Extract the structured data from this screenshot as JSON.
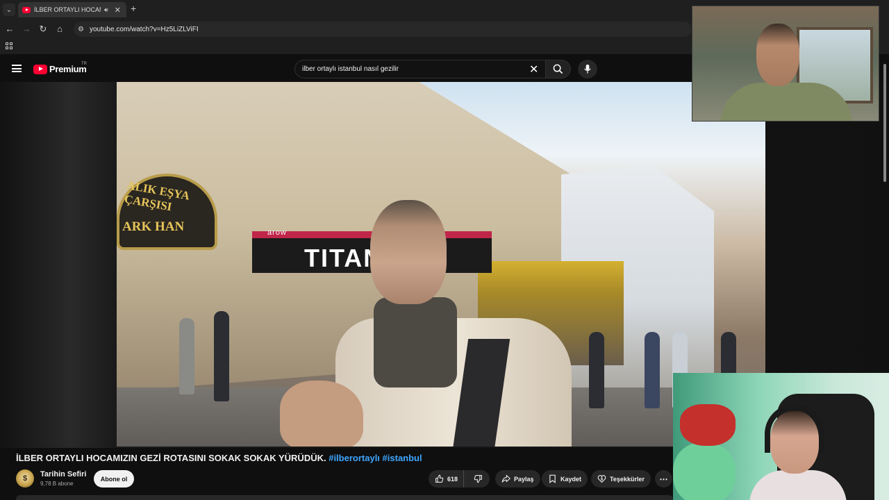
{
  "browser": {
    "tab_title": "İLBER ORTAYLI HOCAMIZIN",
    "url": "youtube.com/watch?v=Hz5LiZLViFI",
    "new_tab_symbol": "+",
    "window_controls": {
      "minimize": "—",
      "maximize": "☐",
      "close": "✕"
    }
  },
  "youtube": {
    "logo_text": "Premium",
    "country_code": "TR",
    "search": {
      "query": "ilber ortaylı istanbul nasıl gezilir"
    }
  },
  "video": {
    "overlay_signs": {
      "round_sign_line1": "ALIK EŞYA ÇARŞISI",
      "round_sign_line2": "ARK HAN",
      "store_brand": "arow",
      "store_name": "TITAN"
    },
    "title": "İLBER ORTAYLI HOCAMIZIN GEZİ ROTASINI SOKAK SOKAK YÜRÜDÜK.",
    "hashtags": [
      "#ilberortaylı",
      "#istanbul"
    ]
  },
  "channel": {
    "name": "Tarihin Sefiri",
    "subscribers": "9,78 B abone",
    "subscribe_label": "Abone ol"
  },
  "actions": {
    "like_count": "618",
    "share_label": "Paylaş",
    "save_label": "Kaydet",
    "thanks_label": "Teşekkürler",
    "more_label": "⋯"
  },
  "colors": {
    "youtube_red": "#ff0033",
    "hashtag_blue": "#3ea6ff",
    "background": "#0f0f0f"
  },
  "icons": [
    "back-icon",
    "forward-icon",
    "reload-icon",
    "home-icon",
    "site-info-icon",
    "apps-icon",
    "menu-icon",
    "close-icon",
    "search-icon",
    "mic-icon",
    "like-icon",
    "dislike-icon",
    "share-icon",
    "save-icon",
    "thanks-icon",
    "more-icon"
  ]
}
